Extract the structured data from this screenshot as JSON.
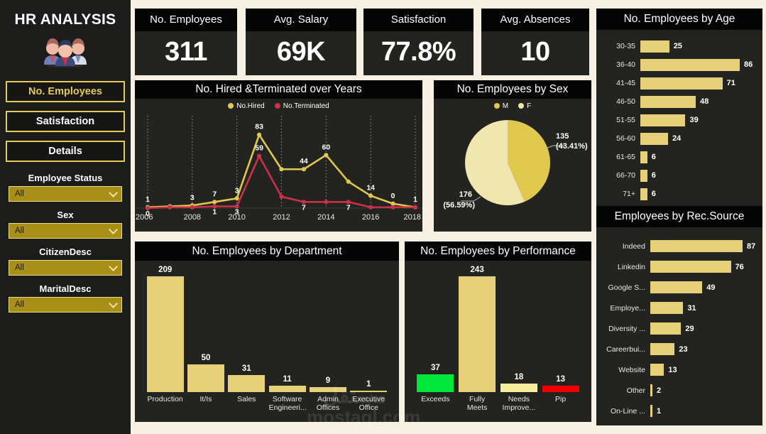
{
  "brand": {
    "title": "HR ANALYSIS",
    "logo_icon": "people-group-icon"
  },
  "nav": {
    "items": [
      {
        "label": "No. Employees",
        "active": true
      },
      {
        "label": "Satisfaction",
        "active": false
      },
      {
        "label": "Details",
        "active": false
      }
    ]
  },
  "filters": [
    {
      "label": "Employee Status",
      "value": "All"
    },
    {
      "label": "Sex",
      "value": "All"
    },
    {
      "label": "CitizenDesc",
      "value": "All"
    },
    {
      "label": "MaritalDesc",
      "value": "All"
    }
  ],
  "kpis": [
    {
      "title": "No. Employees",
      "value": "311"
    },
    {
      "title": "Avg. Salary",
      "value": "69K"
    },
    {
      "title": "Satisfaction",
      "value": "77.8%"
    },
    {
      "title": "Avg. Absences",
      "value": "10"
    }
  ],
  "colors": {
    "gold": "#e6d07a",
    "gold_dark": "#e0c84f",
    "cream": "#f0e6b0",
    "red": "#c9304a",
    "green": "#00e83c",
    "pip_red": "#f00000",
    "panel_bg": "#232320",
    "header_bg": "#050505",
    "page_bg": "#f6f1e2",
    "sidebar_bg": "#1c1c1a"
  },
  "watermark": {
    "arabic": "مستقل",
    "latin": "mostaql.com"
  },
  "chart_data": [
    {
      "id": "hired_terminated",
      "type": "line",
      "title": "No. Hired &Terminated over Years",
      "xlabel": "",
      "ylabel": "",
      "x": [
        2006,
        2007,
        2008,
        2009,
        2010,
        2011,
        2012,
        2013,
        2014,
        2015,
        2016,
        2017,
        2018
      ],
      "tick_labels": [
        "2006",
        "",
        "2008",
        "",
        "2010",
        "",
        "2012",
        "",
        "2014",
        "",
        "2016",
        "",
        "2018"
      ],
      "ylim": [
        0,
        90
      ],
      "grid": "vertical-dotted",
      "legend_position": "top-center",
      "series": [
        {
          "name": "No.Hired",
          "color": "#e0c84f",
          "values": [
            1,
            2,
            3,
            7,
            11,
            83,
            44,
            44,
            60,
            30,
            14,
            5,
            1
          ],
          "labels": [
            "1",
            "",
            "3",
            "7",
            "3",
            "83",
            "",
            "44",
            "60",
            "",
            "14",
            "0",
            "1"
          ]
        },
        {
          "name": "No.Terminated",
          "color": "#c9304a",
          "values": [
            0,
            1,
            1,
            2,
            2,
            59,
            13,
            7,
            7,
            7,
            1,
            1,
            1
          ],
          "labels": [
            "0",
            "",
            "",
            "1",
            "3",
            "59",
            "",
            "7",
            "",
            "7",
            "",
            "",
            ""
          ]
        }
      ]
    },
    {
      "id": "employees_by_sex",
      "type": "pie",
      "title": "No. Employees by Sex",
      "legend_position": "top-center",
      "legend": [
        "M",
        "F"
      ],
      "slices": [
        {
          "name": "M",
          "value": 135,
          "percent": "43.41%",
          "label": "135",
          "sublabel": "(43.41%)",
          "color": "#e0c84f"
        },
        {
          "name": "F",
          "value": 176,
          "percent": "56.59%",
          "label": "176",
          "sublabel": "(56.59%)",
          "color": "#f0e6b0"
        }
      ]
    },
    {
      "id": "employees_by_age",
      "type": "bar",
      "orientation": "horizontal",
      "title": "No. Employees by Age",
      "categories": [
        "30-35",
        "36-40",
        "41-45",
        "46-50",
        "51-55",
        "56-60",
        "61-65",
        "66-70",
        "71+"
      ],
      "values": [
        25,
        86,
        71,
        48,
        39,
        24,
        6,
        6,
        6
      ],
      "xlim": [
        0,
        86
      ],
      "grid": false
    },
    {
      "id": "employees_by_rec_source",
      "type": "bar",
      "orientation": "horizontal",
      "title": "Employees by Rec.Source",
      "categories": [
        "Indeed",
        "Linkedin",
        "Google S...",
        "Employe...",
        "Diversity ...",
        "Careerbui...",
        "Website",
        "Other",
        "On-Line ..."
      ],
      "values": [
        87,
        76,
        49,
        31,
        29,
        23,
        13,
        2,
        1
      ],
      "xlim": [
        0,
        87
      ],
      "grid": false
    },
    {
      "id": "employees_by_department",
      "type": "bar",
      "orientation": "vertical",
      "title": "No. Employees by Department",
      "categories": [
        "Production",
        "It/Is",
        "Sales",
        "Software Engineeri...",
        "Admin Offices",
        "Executive Office"
      ],
      "values": [
        209,
        50,
        31,
        11,
        9,
        1
      ],
      "ylim": [
        0,
        209
      ],
      "grid": false
    },
    {
      "id": "employees_by_performance",
      "type": "bar",
      "orientation": "vertical",
      "title": "No. Employees by Performance",
      "categories": [
        "Exceeds",
        "Fully Meets",
        "Needs Improve...",
        "Pip"
      ],
      "values": [
        37,
        243,
        18,
        13
      ],
      "colors": [
        "#00e83c",
        "#e6d07a",
        "#f7ef9d",
        "#f00000"
      ],
      "ylim": [
        0,
        243
      ],
      "grid": false
    }
  ]
}
